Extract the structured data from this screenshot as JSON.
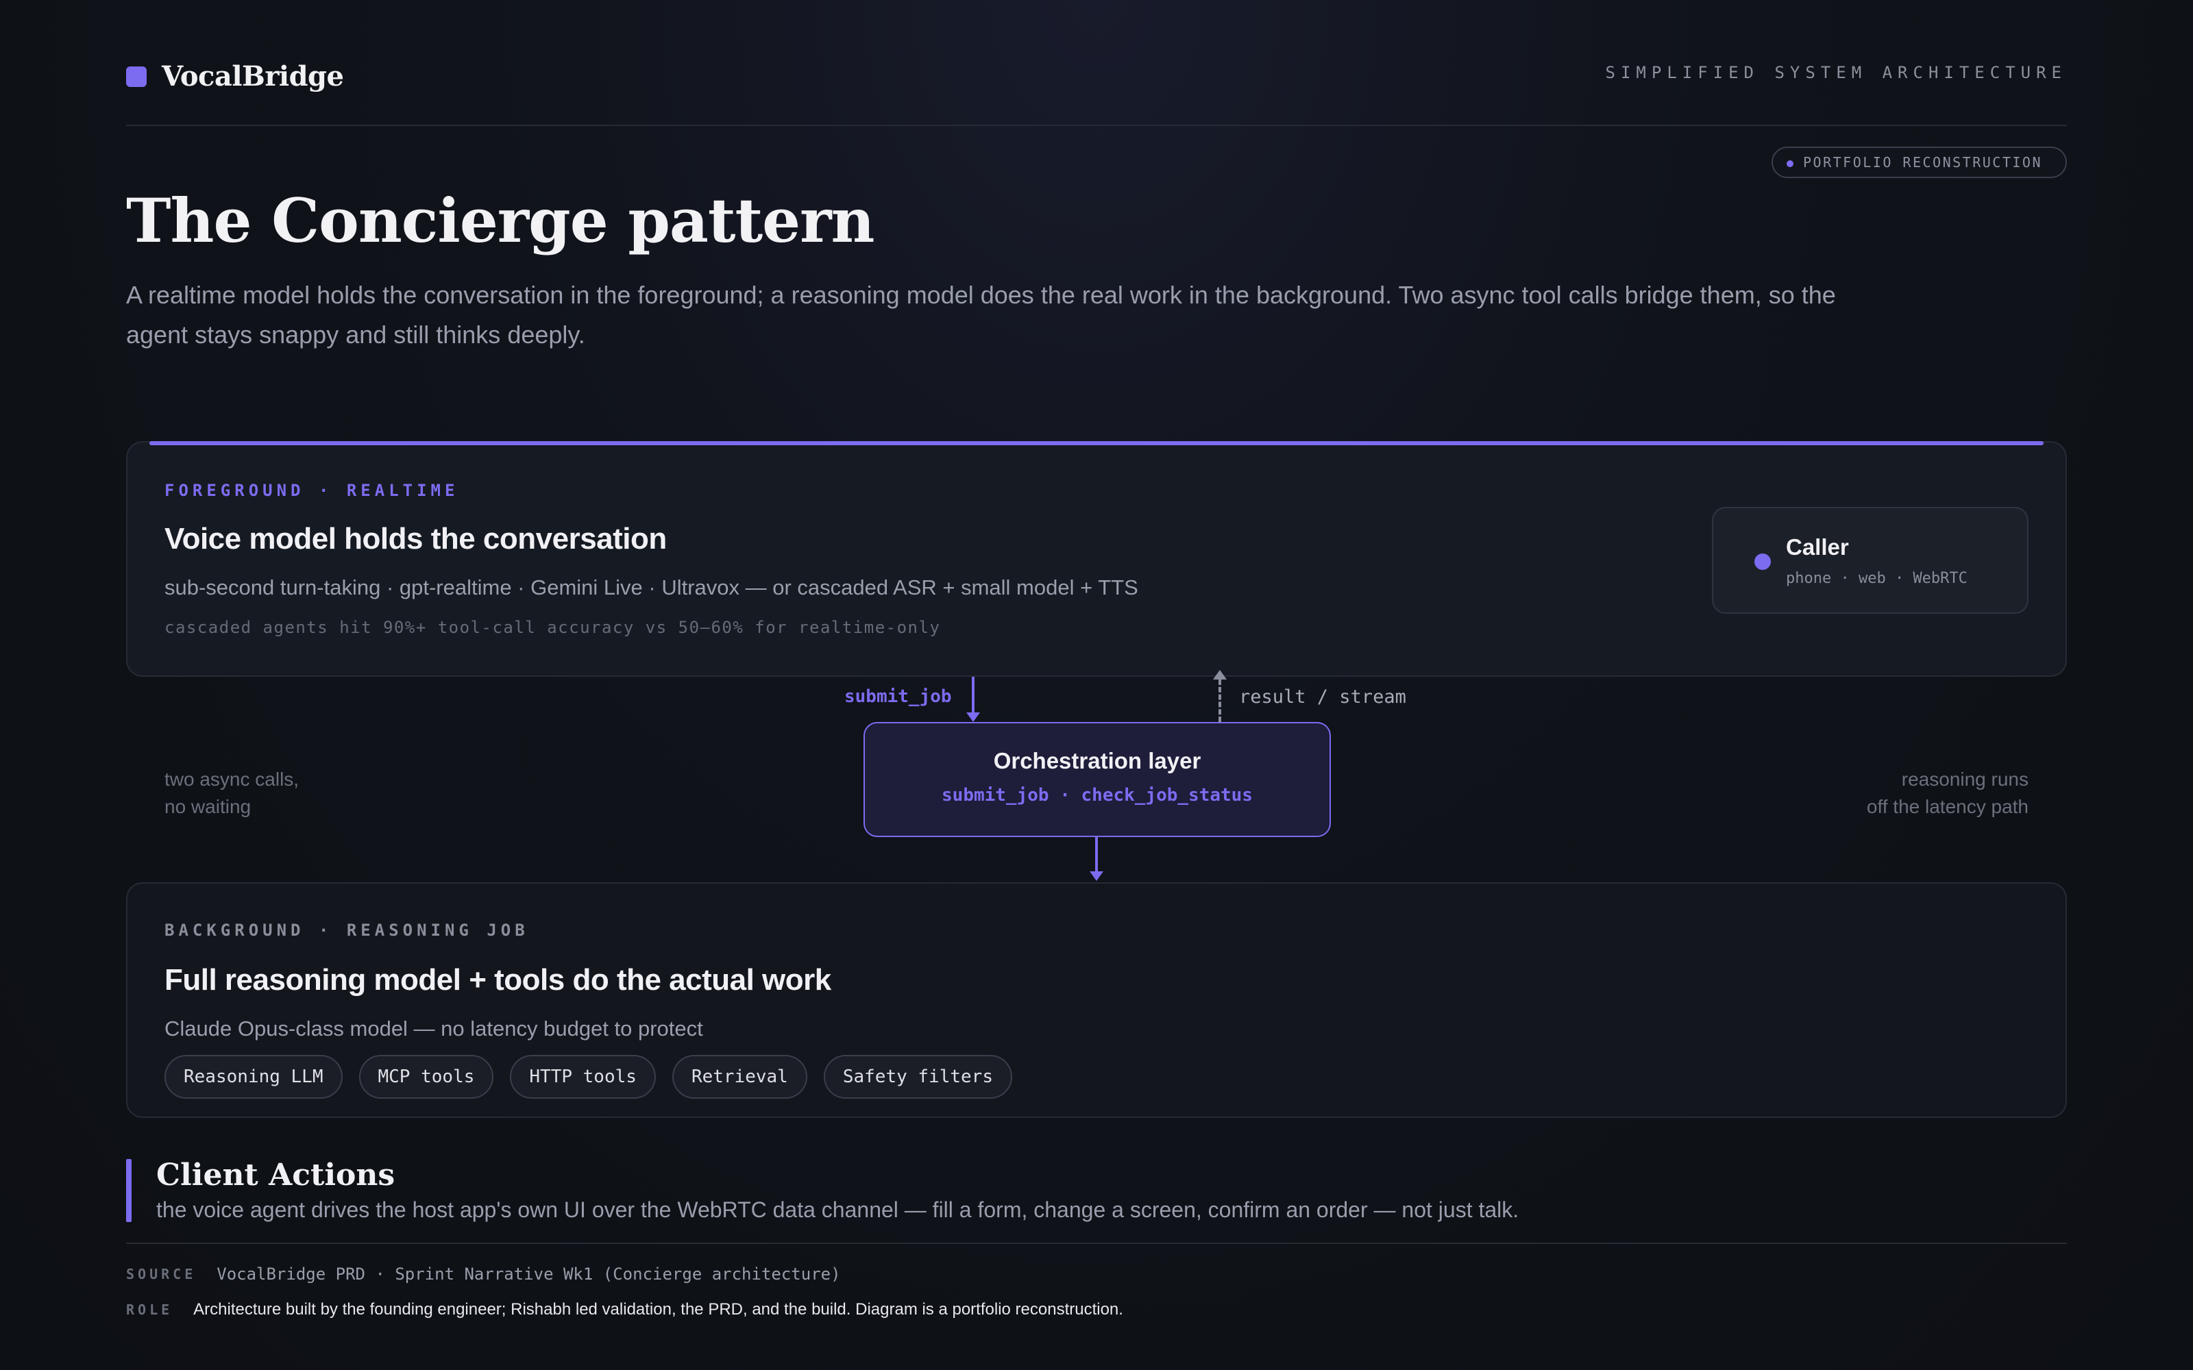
{
  "header": {
    "brand": "VocalBridge",
    "right_label": "SIMPLIFIED SYSTEM ARCHITECTURE",
    "badge": "PORTFOLIO RECONSTRUCTION"
  },
  "hero": {
    "title": "The Concierge pattern",
    "lead": "A realtime model holds the conversation in the foreground; a reasoning model does the real work in the background. Two async tool calls bridge them, so the agent stays snappy and still thinks deeply."
  },
  "foreground": {
    "eyebrow": "FOREGROUND · REALTIME",
    "title": "Voice model holds the conversation",
    "subtitle": "sub-second turn-taking · gpt-realtime · Gemini Live · Ultravox — or cascaded ASR + small model + TTS",
    "note": "cascaded agents hit 90%+ tool-call accuracy vs 50–60% for realtime-only",
    "caller": {
      "title": "Caller",
      "subtitle": "phone · web · WebRTC"
    }
  },
  "connectors": {
    "down_label": "submit_job",
    "up_label": "result / stream"
  },
  "orchestration": {
    "title": "Orchestration layer",
    "subtitle": "submit_job · check_job_status"
  },
  "side_notes": {
    "left_line1": "two async calls,",
    "left_line2": "no waiting",
    "right_line1": "reasoning runs",
    "right_line2": "off the latency path"
  },
  "background": {
    "eyebrow": "BACKGROUND · REASONING JOB",
    "title": "Full reasoning model + tools do the actual work",
    "subtitle": "Claude Opus-class model — no latency budget to protect",
    "tags": [
      "Reasoning LLM",
      "MCP tools",
      "HTTP tools",
      "Retrieval",
      "Safety filters"
    ]
  },
  "client_actions": {
    "title": "Client Actions",
    "subtitle": "the voice agent drives the host app's own UI over the WebRTC data channel — fill a form, change a screen, confirm an order — not just talk."
  },
  "footer": {
    "source_key": "SOURCE",
    "source_value": "VocalBridge PRD · Sprint Narrative Wk1 (Concierge architecture)",
    "role_key": "ROLE",
    "role_value": "Architecture built by the founding engineer; Rishabh led validation, the PRD, and the build. Diagram is a portfolio reconstruction."
  },
  "colors": {
    "accent": "#7c6cf0",
    "background": "#0f1218"
  }
}
